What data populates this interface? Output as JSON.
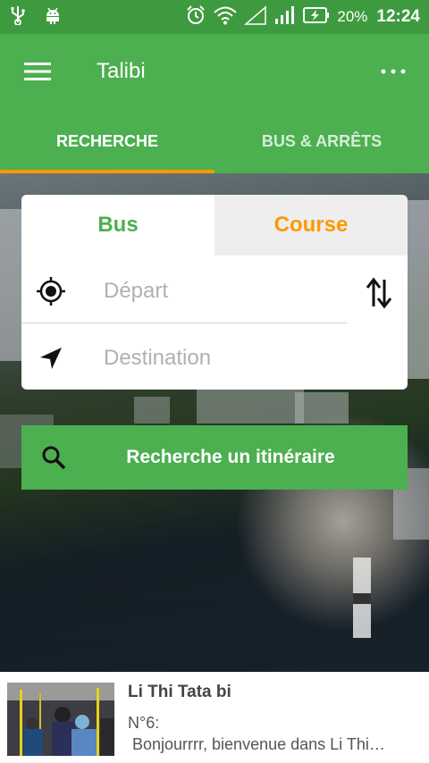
{
  "status_bar": {
    "battery": "20%",
    "time": "12:24",
    "icons": [
      "usb-icon",
      "android-icon",
      "alarm-icon",
      "wifi-icon",
      "signal-empty-icon",
      "signal-bars-icon",
      "battery-charging-icon"
    ]
  },
  "app_bar": {
    "title": "Talibi",
    "menu_icon": "hamburger-icon",
    "more_icon": "more-horizontal-icon"
  },
  "tabs": [
    {
      "label": "RECHERCHE",
      "active": true
    },
    {
      "label": "BUS & ARRÊTS",
      "active": false
    }
  ],
  "search_card": {
    "mode_tabs": [
      {
        "label": "Bus",
        "selected": true
      },
      {
        "label": "Course",
        "selected": false
      }
    ],
    "depart": {
      "placeholder": "Départ",
      "value": "",
      "icon": "my-location-icon"
    },
    "destination": {
      "placeholder": "Destination",
      "value": "",
      "icon": "navigation-arrow-icon"
    },
    "swap_icon": "swap-vertical-icon"
  },
  "search_button": {
    "label": "Recherche un itinéraire",
    "icon": "search-icon"
  },
  "news": {
    "title": "Li Thi Tata bi",
    "body_line1": "N°6:",
    "body_line2": " Bonjourrrr, bienvenue dans Li Thi…"
  },
  "colors": {
    "status_bar": "#3e9a3f",
    "primary": "#4caf50",
    "accent": "#ff9800"
  }
}
